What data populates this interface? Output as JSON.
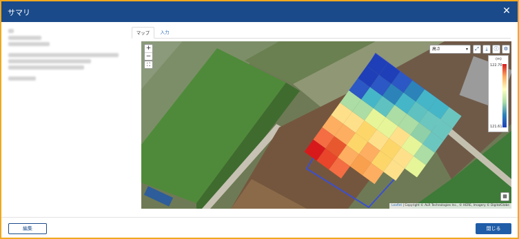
{
  "dialog": {
    "title": "サマリ",
    "close_glyph": "✕"
  },
  "tabs": [
    {
      "label": "マップ",
      "active": true
    },
    {
      "label": "入力",
      "active": false
    }
  ],
  "map": {
    "zoom_in": "+",
    "zoom_out": "−",
    "fit_glyph": "⛶",
    "layer_select": {
      "value": "高さ",
      "caret": "▾"
    },
    "buttons": [
      {
        "name": "expand-icon",
        "glyph": "⤢"
      },
      {
        "name": "download-icon",
        "glyph": "⤓"
      },
      {
        "name": "info-icon",
        "glyph": "ⓘ"
      },
      {
        "name": "settings-icon",
        "glyph": "⚙"
      }
    ],
    "legend": {
      "unit": "(m)",
      "max": "122.70",
      "min": "121.61"
    },
    "map_glyph": "▦",
    "attribution": {
      "link": "Leaflet",
      "text": " | Copyright © ALR Technologies Inc., © HERE, Imagery © DigitalGlobe"
    }
  },
  "footer": {
    "edit_label": "編集",
    "close_label": "閉じる"
  },
  "colors": {
    "titlebar": "#1a4a8a",
    "accent": "#1f5da8",
    "frame": "#f0a81e"
  }
}
